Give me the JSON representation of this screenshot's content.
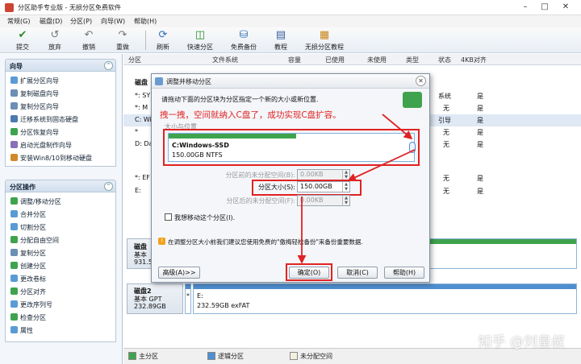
{
  "window": {
    "title": "分区助手专业版 - 无损分区免费软件"
  },
  "menu": [
    "常规(G)",
    "磁盘(D)",
    "分区(P)",
    "向导(W)",
    "帮助(H)"
  ],
  "toolbar": {
    "left": [
      {
        "label": "提交",
        "icon": "check-icon"
      },
      {
        "label": "放弃",
        "icon": "discard-icon"
      },
      {
        "label": "撤销",
        "icon": "undo-icon"
      },
      {
        "label": "重做",
        "icon": "redo-icon"
      }
    ],
    "right": [
      {
        "label": "刷新",
        "icon": "refresh-icon"
      },
      {
        "label": "快速分区",
        "icon": "quick-partition-icon"
      },
      {
        "label": "免费备份",
        "icon": "backup-icon"
      },
      {
        "label": "教程",
        "icon": "tutorial-icon"
      },
      {
        "label": "无损分区教程",
        "icon": "tutorial-book-icon"
      }
    ]
  },
  "sidebar": {
    "wizard_title": "向导",
    "wizard_items": [
      "扩展分区向导",
      "复制磁盘向导",
      "复制分区向导",
      "迁移系统到固态硬盘",
      "分区恢复向导",
      "启动光盘制作向导",
      "安装Win8/10到移动硬盘"
    ],
    "ops_title": "分区操作",
    "ops_items": [
      "调整/移动分区",
      "合并分区",
      "切割分区",
      "分配自由空间",
      "复制分区",
      "创建分区",
      "更改卷标",
      "分区对齐",
      "更改序列号",
      "检查分区",
      "属性"
    ]
  },
  "table": {
    "headers": [
      "分区",
      "文件系统",
      "容量",
      "已使用",
      "未使用",
      "类型",
      "状态",
      "4KB对齐"
    ],
    "disk1_label": "磁盘",
    "disk1_rows": [
      {
        "name": "*: SY",
        "status": "系统",
        "align": "是"
      },
      {
        "name": "*: M",
        "status": "无",
        "align": "是"
      },
      {
        "name": "C: Wi",
        "status": "引导",
        "align": "是"
      },
      {
        "name": "*",
        "status": "无",
        "align": "是"
      },
      {
        "name": "D: Da",
        "status": "无",
        "align": "是"
      }
    ],
    "disk2_rows": [
      {
        "name": "*: EF",
        "status": "无",
        "align": "是"
      },
      {
        "name": "E:",
        "status": "无",
        "align": "是"
      }
    ]
  },
  "disks": [
    {
      "name": "磁盘",
      "type": "基本",
      "size": "931.5"
    },
    {
      "name": "磁盘2",
      "type": "基本 GPT",
      "size": "232.89GB",
      "part_letter": "*",
      "part_name": "E:",
      "part_info": "232.59GB exFAT"
    }
  ],
  "legend": [
    "主分区",
    "逻辑分区",
    "未分配空间"
  ],
  "dialog": {
    "title": "调整并移动分区",
    "instruction": "请拖动下面的分区块为分区指定一个新的大小或新位置.",
    "annotation": "拽一拽，空间就纳入C盘了，成功实现C盘扩容。",
    "group_label": "大小与位置",
    "partition_name": "C:Windows-SSD",
    "partition_info": "150.00GB NTFS",
    "used_fraction": 0.52,
    "before_label": "分区前的未分配空间(B):",
    "before_value": "0.00KB",
    "size_label": "分区大小(S):",
    "size_value": "150.00GB",
    "after_label": "分区后的未分配空间(F):",
    "after_value": "0.00KB",
    "move_checkbox": "我想移动这个分区(I).",
    "warning": "在调整分区大小前我们建议您使用免费的\"傲梅轻松备份\"来备份重要数据.",
    "advanced_btn": "高级(A)>>",
    "ok_btn": "确定(O)",
    "cancel_btn": "取消(C)",
    "help_btn": "帮助(H)"
  },
  "watermark": "知乎 @刘皇叔"
}
